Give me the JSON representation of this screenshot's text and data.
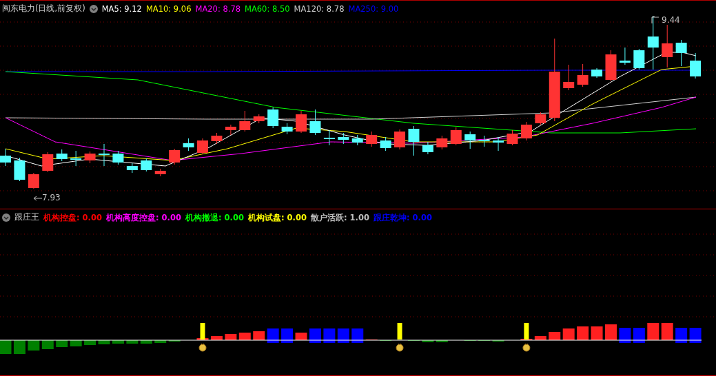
{
  "price_panel": {
    "title": "闽东电力(日线,前复权)",
    "indicators": [
      {
        "text": "MA5: 9.12",
        "color": "#ffffff"
      },
      {
        "text": "MA10: 9.06",
        "color": "#ffff00"
      },
      {
        "text": "MA20: 8.78",
        "color": "#ff00ff"
      },
      {
        "text": "MA60: 8.50",
        "color": "#00ff00"
      },
      {
        "text": "MA120: 8.78",
        "color": "#d0d0d0"
      },
      {
        "text": "MA250: 9.00",
        "color": "#0000ff"
      }
    ],
    "high_label": "9.44",
    "low_label": "7.93"
  },
  "indicator_panel": {
    "title": "跟庄王",
    "indicators": [
      {
        "text": "机构控盘: 0.00",
        "color": "#ff0000"
      },
      {
        "text": "机构高度控盘: 0.00",
        "color": "#ff00ff"
      },
      {
        "text": "机构撤退: 0.00",
        "color": "#00ff00"
      },
      {
        "text": "机构试盘: 0.00",
        "color": "#ffff00"
      },
      {
        "text": "散户活跃: 1.00",
        "color": "#c0c0c0"
      },
      {
        "text": "跟庄乾坤: 0.00",
        "color": "#0000ff"
      }
    ]
  }
}
